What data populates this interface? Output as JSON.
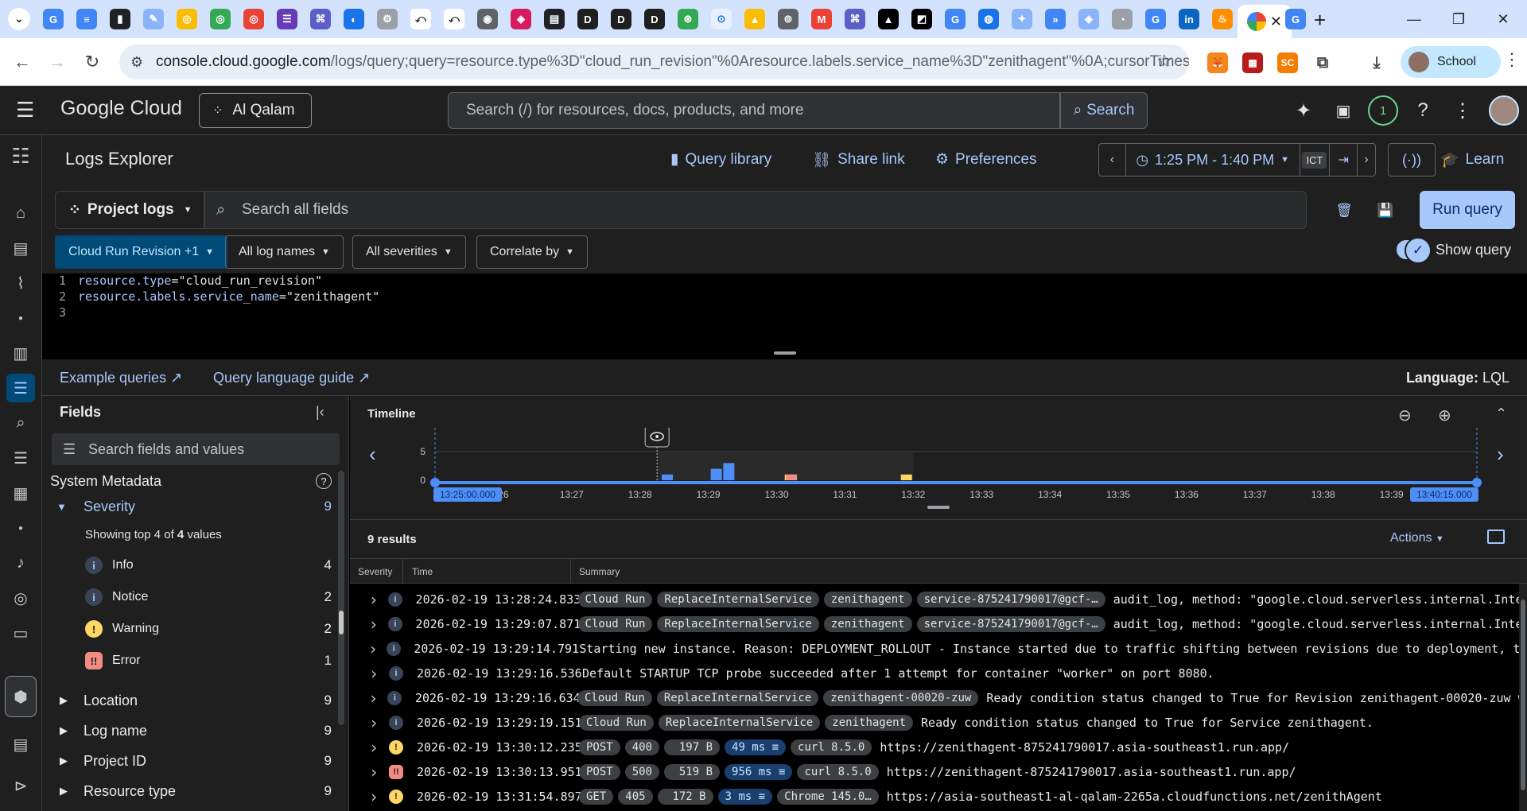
{
  "browser": {
    "url_main": "console.cloud.google.com",
    "url_rest": "/logs/query;query=resource.type%3D\"cloud_run_revision\"%0Aresource.labels.service_name%3D\"zenithagent\"%0A;cursorTimestamp=…",
    "profile": "School"
  },
  "gcp": {
    "brand": "Google Cloud",
    "project": "Al Qalam",
    "search_placeholder": "Search (/) for resources, docs, products, and more",
    "search_button": "Search",
    "notif_count": "1"
  },
  "toolbar": {
    "title": "Logs Explorer",
    "query_library": "Query library",
    "share_link": "Share link",
    "preferences": "Preferences",
    "time_range": "1:25 PM - 1:40 PM",
    "timezone": "ICT",
    "learn": "Learn"
  },
  "query": {
    "project_logs": "Project logs",
    "search_placeholder": "Search all fields",
    "run": "Run query"
  },
  "chips": {
    "resource": "Cloud Run Revision +1",
    "log_names": "All log names",
    "severities": "All severities",
    "correlate": "Correlate by",
    "show_query": "Show query"
  },
  "editor": {
    "lines": [
      "1",
      "2",
      "3"
    ],
    "line1_key": "resource.type",
    "line1_val": "\"cloud_run_revision\"",
    "line2_key": "resource.labels.service_name",
    "line2_val": "\"zenithagent\""
  },
  "links": {
    "examples": "Example queries",
    "guide": "Query language guide",
    "language_label": "Language:",
    "language": "LQL"
  },
  "fields": {
    "title": "Fields",
    "search_placeholder": "Search fields and values",
    "section": "System Metadata",
    "severity": {
      "label": "Severity",
      "count": "9"
    },
    "showing_top": "Showing top 4 of",
    "showing_count": "4",
    "showing_rest": "values",
    "values": [
      {
        "label": "Info",
        "count": "4",
        "icon": "i",
        "color": "#a8c7fa"
      },
      {
        "label": "Notice",
        "count": "2",
        "icon": "i",
        "color": "#a8c7fa"
      },
      {
        "label": "Warning",
        "count": "2",
        "icon": "!",
        "color": "#fdd663"
      },
      {
        "label": "Error",
        "count": "1",
        "icon": "!!",
        "color": "#f28b82"
      }
    ],
    "groups": [
      {
        "label": "Location",
        "count": "9"
      },
      {
        "label": "Log name",
        "count": "9"
      },
      {
        "label": "Project ID",
        "count": "9"
      },
      {
        "label": "Resource type",
        "count": "9"
      }
    ]
  },
  "timeline": {
    "title": "Timeline",
    "start": "13:25:00.000",
    "end": "13:40:15.000",
    "y_ticks": [
      "5",
      "0"
    ],
    "ticks": [
      "26",
      "13:27",
      "13:28",
      "13:29",
      "13:30",
      "13:31",
      "13:32",
      "13:33",
      "13:34",
      "13:35",
      "13:36",
      "13:37",
      "13:38",
      "13:39"
    ]
  },
  "chart_data": {
    "type": "bar",
    "title": "Timeline",
    "x_label": "",
    "ylim": [
      0,
      5
    ],
    "series": [
      {
        "name": "Info/Notice",
        "color": "#4f8ef7",
        "points": [
          {
            "x": "13:28:24",
            "y": 1
          },
          {
            "x": "13:29:07",
            "y": 2
          },
          {
            "x": "13:29:18",
            "y": 3
          }
        ]
      },
      {
        "name": "Warning",
        "color": "#fdd663",
        "points": [
          {
            "x": "13:30:12",
            "y": 1
          },
          {
            "x": "13:31:54",
            "y": 1
          }
        ]
      },
      {
        "name": "Error",
        "color": "#f28b82",
        "points": [
          {
            "x": "13:30:13",
            "y": 1
          }
        ]
      }
    ]
  },
  "results": {
    "count_text": "9 results",
    "actions": "Actions",
    "columns": [
      "Severity",
      "Time",
      "Summary"
    ],
    "rows": [
      {
        "sev": "i",
        "time": "2026-02-19 13:28:24.833",
        "tags": [
          "Cloud Run",
          "ReplaceInternalService",
          "zenithagent",
          "service-875241790017@gcf-…"
        ],
        "text": "audit_log, method: \"google.cloud.serverless.internal.Intern…"
      },
      {
        "sev": "i",
        "time": "2026-02-19 13:29:07.871",
        "tags": [
          "Cloud Run",
          "ReplaceInternalService",
          "zenithagent",
          "service-875241790017@gcf-…"
        ],
        "text": "audit_log, method: \"google.cloud.serverless.internal.Intern…"
      },
      {
        "sev": "i",
        "time": "2026-02-19 13:29:14.791",
        "tags": [],
        "text": "Starting new instance. Reason: DEPLOYMENT_ROLLOUT - Instance started due to traffic shifting between revisions due to deployment, traffic s…"
      },
      {
        "sev": "i",
        "time": "2026-02-19 13:29:16.536",
        "tags": [],
        "text": "Default STARTUP TCP probe succeeded after 1 attempt for container \"worker\" on port 8080."
      },
      {
        "sev": "i",
        "time": "2026-02-19 13:29:16.634",
        "tags": [
          "Cloud Run",
          "ReplaceInternalService",
          "zenithagent-00020-zuw"
        ],
        "text": "Ready condition status changed to True for Revision zenithagent-00020-zuw with…"
      },
      {
        "sev": "i",
        "time": "2026-02-19 13:29:19.151",
        "tags": [
          "Cloud Run",
          "ReplaceInternalService",
          "zenithagent"
        ],
        "text": "Ready condition status changed to True for Service zenithagent."
      },
      {
        "sev": "!",
        "time": "2026-02-19 13:30:12.235",
        "http": [
          "POST",
          "400",
          "197 B",
          "49 ms",
          "curl 8.5.0"
        ],
        "text": "https://zenithagent-875241790017.asia-southeast1.run.app/"
      },
      {
        "sev": "!!",
        "time": "2026-02-19 13:30:13.951",
        "http": [
          "POST",
          "500",
          "519 B",
          "956 ms",
          "curl 8.5.0"
        ],
        "text": "https://zenithagent-875241790017.asia-southeast1.run.app/"
      },
      {
        "sev": "!",
        "time": "2026-02-19 13:31:54.897",
        "http": [
          "GET",
          "405",
          "172 B",
          "3 ms",
          "Chrome 145.0…"
        ],
        "text": "https://asia-southeast1-al-qalam-2265a.cloudfunctions.net/zenithAgent"
      }
    ]
  }
}
